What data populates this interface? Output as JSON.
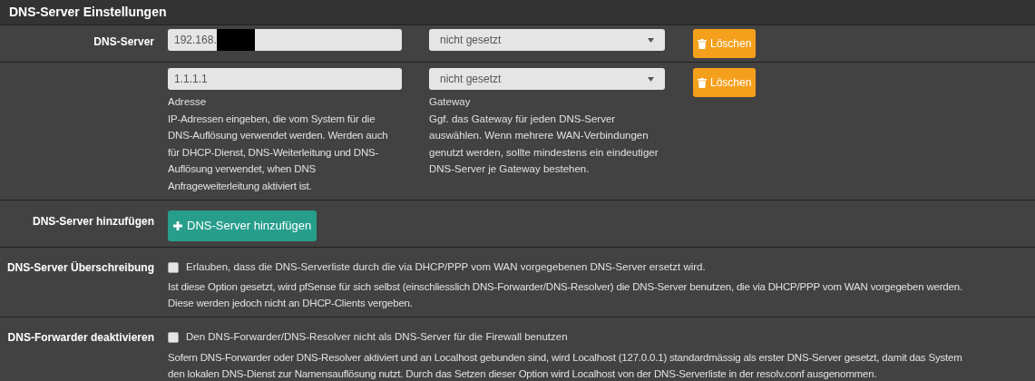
{
  "panel": {
    "title": "DNS-Server Einstellungen"
  },
  "servers": [
    {
      "label": "DNS-Server",
      "address": "192.168.",
      "redacted": true,
      "gateway": "nicht gesetzt",
      "delete": "Löschen"
    },
    {
      "address": "1.1.1.1",
      "redacted": false,
      "gateway": "nicht gesetzt",
      "delete": "Löschen",
      "address_help_title": "Adresse",
      "address_help": "IP-Adressen eingeben, die vom System für die DNS-Auflösung verwendet werden. Werden auch für DHCP-Dienst, DNS-Weiterleitung und DNS-Auflösung verwendet, when DNS Anfrageweiterleitung aktiviert ist.",
      "gateway_help_title": "Gateway",
      "gateway_help": "Ggf. das Gateway für jeden DNS-Server auswählen. Wenn mehrere WAN-Verbindungen genutzt werden, sollte mindestens ein eindeutiger DNS-Server je Gateway bestehen."
    }
  ],
  "add_row": {
    "label": "DNS-Server hinzufügen",
    "button": "DNS-Server hinzufügen"
  },
  "options": [
    {
      "label": "DNS-Server Überschreibung",
      "checked": false,
      "text": "Erlauben, dass die DNS-Serverliste durch die via DHCP/PPP vom WAN vorgegebenen DNS-Server ersetzt wird.",
      "help": [
        "Ist diese Option gesetzt, wird pfSense für sich selbst (einschliesslich DNS-Forwarder/DNS-Resolver) die DNS-Server benutzen, die via DHCP/PPP vom WAN vorgegeben werden.",
        "Diese werden jedoch nicht an DHCP-Clients vergeben."
      ]
    },
    {
      "label": "DNS-Forwarder deaktivieren",
      "checked": false,
      "text": "Den DNS-Forwarder/DNS-Resolver nicht als DNS-Server für die Firewall benutzen",
      "help": [
        "Sofern DNS-Forwarder oder DNS-Resolver aktiviert und an Localhost gebunden sind, wird Localhost (127.0.0.1) standardmässig als erster DNS-Server gesetzt, damit das System",
        "den lokalen DNS-Dienst zur Namensauflösung nutzt. Durch das Setzen dieser Option wird Localhost von der DNS-Serverliste in der resolv.conf ausgenommen."
      ]
    }
  ]
}
